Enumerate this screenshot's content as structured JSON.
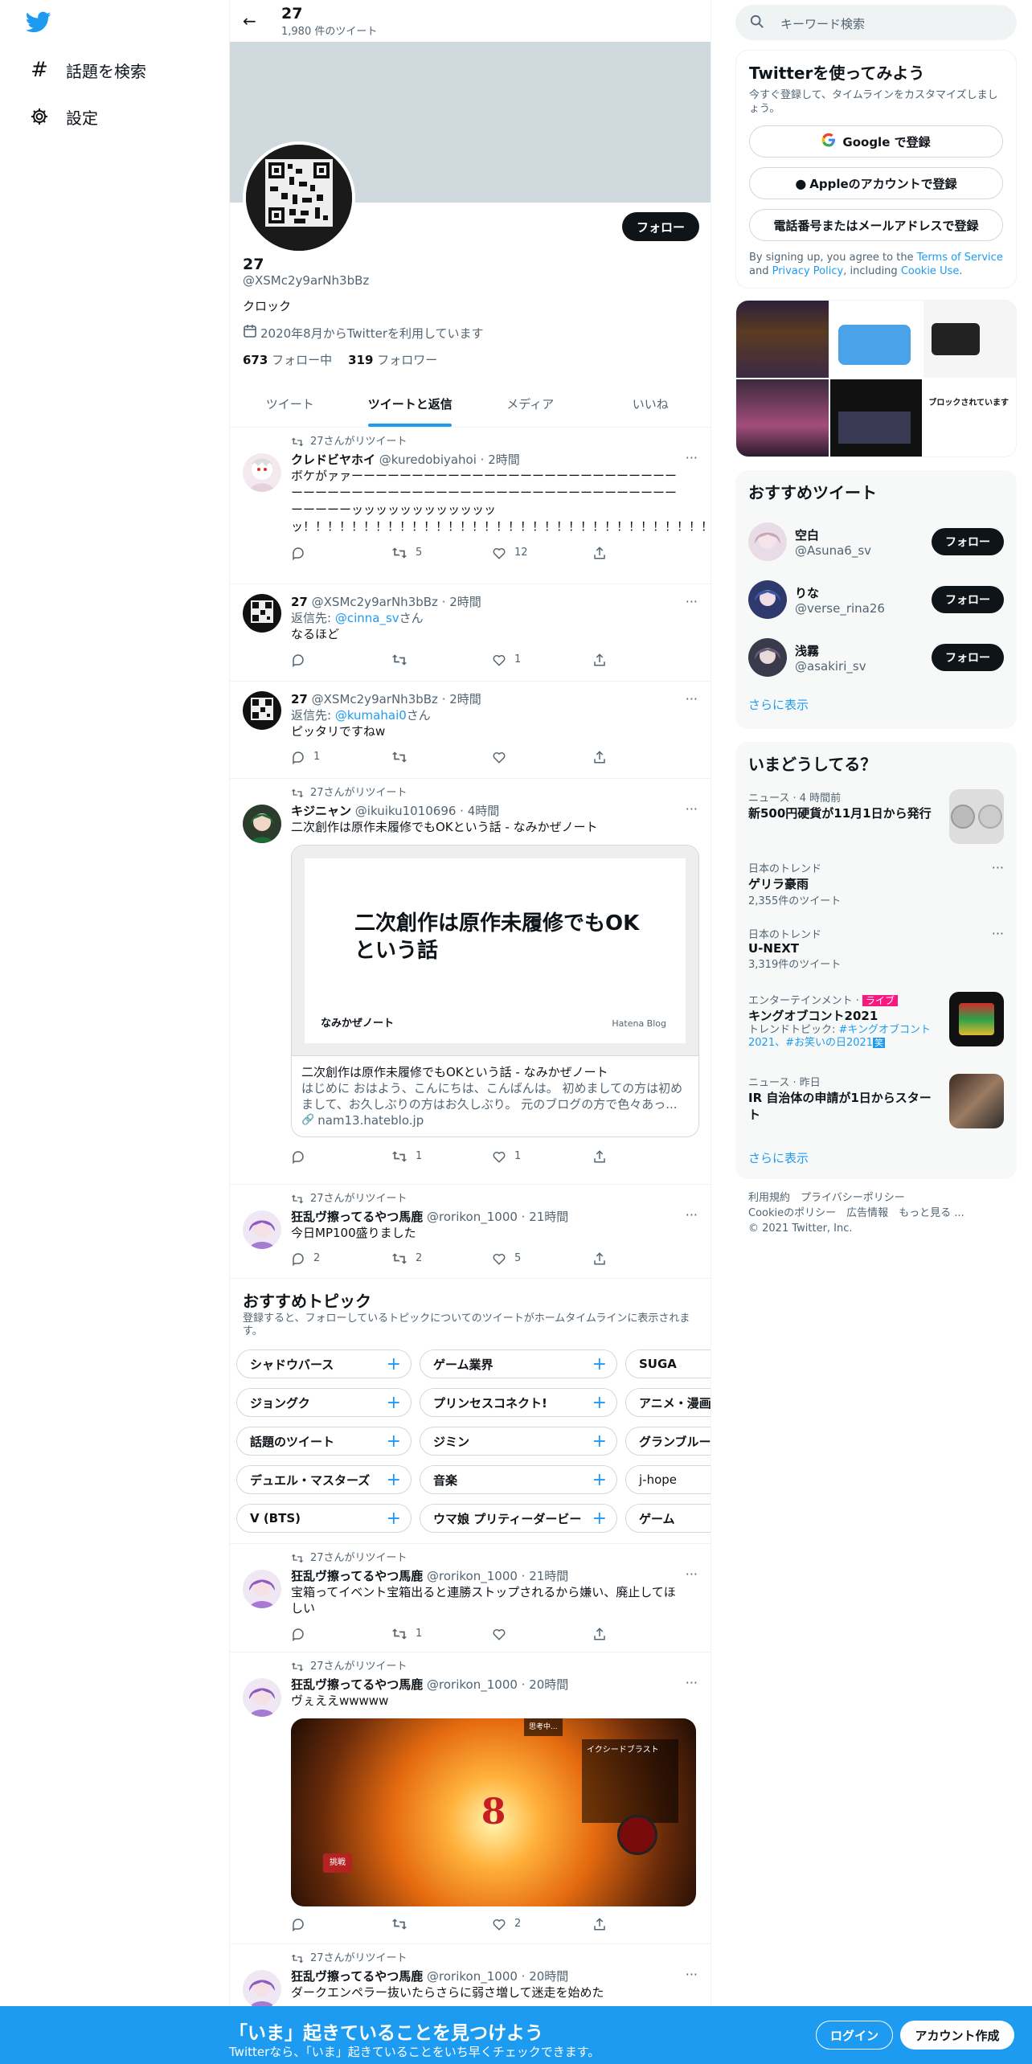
{
  "nav": {
    "explore_label": "話題を検索",
    "settings_label": "設定"
  },
  "header": {
    "name": "27",
    "tweet_count": "1,980 件のツイート"
  },
  "profile": {
    "follow_label": "フォロー",
    "name": "27",
    "handle": "@XSMc2y9arNh3bBz",
    "bio": "クロック",
    "joined": "2020年8月からTwitterを利用しています",
    "following_count": "673",
    "following_label": "フォロー中",
    "followers_count": "319",
    "followers_label": "フォロワー"
  },
  "tabs": [
    "ツイート",
    "ツイートと返信",
    "メディア",
    "いいね"
  ],
  "tweets": [
    {
      "retweet_label": "27さんがリツイート",
      "name": "クレドビヤホイ",
      "meta": "@kuredobiyahoi · 2時間",
      "text": "ボケがァァーーーーーーーーーーーーーーーーーーーーーーーーーーーーーーーーーーーーーーーーーーーーーーーーーーーーーーーーーーーーーーーーッッッッッッッッッッッッッ！！！！！！！！！！！！！！！！！！！！！！！！！！！！！！！！！！！！！！！！！",
      "replies": "",
      "retweets": "5",
      "likes": "12"
    },
    {
      "name": "27",
      "meta": "@XSMc2y9arNh3bBz · 2時間",
      "reply_prefix": "返信先: ",
      "reply_to": "@cinna_sv",
      "reply_suffix": "さん",
      "text": "なるほど",
      "replies": "",
      "retweets": "",
      "likes": "1"
    },
    {
      "name": "27",
      "meta": "@XSMc2y9arNh3bBz · 2時間",
      "reply_prefix": "返信先: ",
      "reply_to": "@kumahai0",
      "reply_suffix": "さん",
      "text": "ピッタリですねw",
      "replies": "1",
      "retweets": "",
      "likes": ""
    },
    {
      "retweet_label": "27さんがリツイート",
      "name": "キジニャン",
      "meta": "@ikuiku1010696 · 4時間",
      "text": "二次創作は原作未履修でもOKという話 - なみかぜノート",
      "card_image_title": "二次創作は原作未履修でもOKという話",
      "card_image_blog": "なみかぜノート",
      "card_image_brand": "Hatena Blog",
      "card_title": "二次創作は原作未履修でもOKという話 - なみかぜノート",
      "card_desc": "はじめに おはよう、こんにちは、こんばんは。 初めましての方は初めまして、お久しぶりの方はお久しぶり。 元のブログの方で色々あっ...",
      "card_domain": "nam13.hateblo.jp",
      "replies": "",
      "retweets": "1",
      "likes": "1"
    },
    {
      "retweet_label": "27さんがリツイート",
      "name": "狂乱ヴ擦ってるやつ馬鹿",
      "meta": "@rorikon_1000 · 21時間",
      "text": "今日MP100盛りました",
      "replies": "2",
      "retweets": "2",
      "likes": "5"
    }
  ],
  "topics": {
    "title": "おすすめトピック",
    "desc": "登録すると、フォローしているトピックについてのツイートがホームタイムラインに表示されます。",
    "chips": [
      [
        "シャドウバース",
        "ゲーム業界",
        "SUGA"
      ],
      [
        "ジョングク",
        "プリンセスコネクト!",
        "アニメ・漫画"
      ],
      [
        "話題のツイート",
        "ジミン",
        "グランブルーファンタジー"
      ],
      [
        "デュエル・マスターズ",
        "音楽",
        "j-hope"
      ],
      [
        "V (BTS)",
        "ウマ娘 プリティーダービー",
        "ゲーム"
      ]
    ]
  },
  "tweets2": [
    {
      "retweet_label": "27さんがリツイート",
      "name": "狂乱ヴ擦ってるやつ馬鹿",
      "meta": "@rorikon_1000 · 21時間",
      "text": "宝箱ってイベント宝箱出ると連勝ストップされるから嫌い、廃止してほしい",
      "replies": "",
      "retweets": "1",
      "likes": ""
    },
    {
      "retweet_label": "27さんがリツイート",
      "name": "狂乱ヴ擦ってるやつ馬鹿",
      "meta": "@rorikon_1000 · 20時間",
      "text": "ヴぇええwwwww",
      "image_number": "8",
      "image_caption": "イクシードブラスト",
      "image_badge": "挑戦",
      "image_top_label": "思考中...",
      "replies": "",
      "retweets": "",
      "likes": "2"
    },
    {
      "retweet_label": "27さんがリツイート",
      "name": "狂乱ヴ擦ってるやつ馬鹿",
      "meta": "@rorikon_1000 · 20時間",
      "text": "ダークエンペラー抜いたらさらに弱さ増して迷走を始めた"
    }
  ],
  "search": {
    "placeholder": "キーワード検索"
  },
  "signup": {
    "title": "Twitterを使ってみよう",
    "desc": "今すぐ登録して、タイムラインをカスタマイズしましょう。",
    "google": "Google で登録",
    "apple": "Appleのアカウントで登録",
    "phone": "電話番号またはメールアドレスで登録",
    "terms_prefix": "By signing up, you agree to the ",
    "terms_link": "Terms of Service",
    "terms_and": " and ",
    "privacy_link": "Privacy Policy",
    "terms_including": ", including ",
    "cookie_link": "Cookie Use",
    "terms_end": "."
  },
  "media_grid": {
    "blocked_label": "ブロックされています"
  },
  "recommended": {
    "title": "おすすめツイート",
    "users": [
      {
        "name": "空白",
        "handle": "@Asuna6_sv"
      },
      {
        "name": "りな",
        "handle": "@verse_rina26"
      },
      {
        "name": "浅霧",
        "handle": "@asakiri_sv"
      }
    ],
    "follow_label": "フォロー",
    "more": "さらに表示"
  },
  "trends": {
    "title": "いまどうしてる？",
    "items": [
      {
        "context": "ニュース · 4 時間前",
        "title": "新500円硬貨が11月1日から発行"
      },
      {
        "context": "日本のトレンド",
        "title": "ゲリラ豪雨",
        "count": "2,355件のツイート"
      },
      {
        "context": "日本のトレンド",
        "title": "U-NEXT",
        "count": "3,319件のツイート"
      },
      {
        "context": "エンターテインメント · ",
        "live": "ライブ",
        "title": "キングオブコント2021",
        "topic_prefix": "トレンドトピック: ",
        "topic_links": "#キングオブコント2021、#お笑いの日2021",
        "topic_badge": "笑"
      },
      {
        "context": "ニュース · 昨日",
        "title": "IR 自治体の申請が1日からスタート"
      }
    ],
    "more": "さらに表示"
  },
  "footer": {
    "line1": [
      "利用規約",
      "プライバシーポリシー"
    ],
    "line2": [
      "Cookieのポリシー",
      "広告情報",
      "もっと見る ..."
    ],
    "copyright": "© 2021 Twitter, Inc."
  },
  "bottom": {
    "headline": "「いま」起きていることを見つけよう",
    "sub": "Twitterなら、「いま」起きていることをいち早くチェックできます。",
    "login": "ログイン",
    "signup": "アカウント作成"
  },
  "colors": {
    "accent": "#1d9bf0",
    "dark": "#0f1419",
    "banner": "#cfd9de",
    "live_badge": "#f91880"
  }
}
